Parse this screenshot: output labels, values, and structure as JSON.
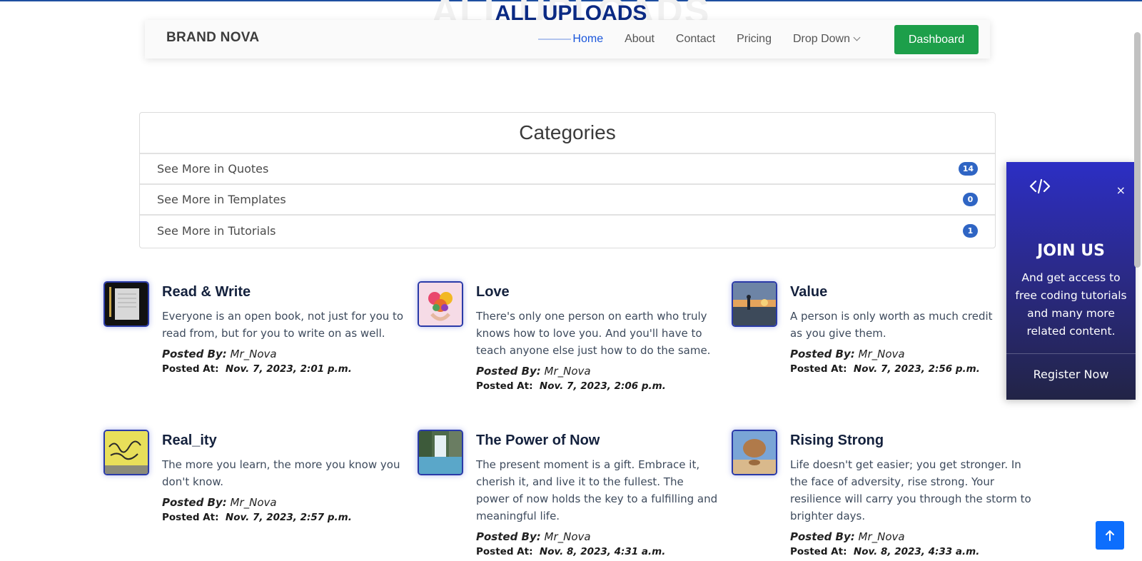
{
  "page": {
    "title_bg": "ALL UPLOADS",
    "title": "ALL UPLOADS"
  },
  "navbar": {
    "brand": "BRAND NOVA",
    "links": [
      {
        "label": "Home"
      },
      {
        "label": "About"
      },
      {
        "label": "Contact"
      },
      {
        "label": "Pricing"
      },
      {
        "label": "Drop Down"
      }
    ],
    "dashboard_label": "Dashboard"
  },
  "categories": {
    "title": "Categories",
    "items": [
      {
        "label": "See More in Quotes",
        "count": "14"
      },
      {
        "label": "See More in Templates",
        "count": "0"
      },
      {
        "label": "See More in Tutorials",
        "count": "1"
      }
    ]
  },
  "posts": [
    {
      "title": "Read & Write",
      "text": "Everyone is an open book, not just for you to read from, but for you to write on as well.",
      "by_label": "Posted By:",
      "author": "Mr_Nova",
      "at_label": "Posted At:",
      "date": "Nov. 7, 2023, 2:01 p.m."
    },
    {
      "title": "Love",
      "text": "There's only one person on earth who truly knows how to love you. And you'll have to teach anyone else just how to do the same.",
      "by_label": "Posted By:",
      "author": "Mr_Nova",
      "at_label": "Posted At:",
      "date": "Nov. 7, 2023, 2:06 p.m."
    },
    {
      "title": "Value",
      "text": "A person is only worth as much credit as you give them.",
      "by_label": "Posted By:",
      "author": "Mr_Nova",
      "at_label": "Posted At:",
      "date": "Nov. 7, 2023, 2:56 p.m."
    },
    {
      "title": "Real_ity",
      "text": "The more you learn, the more you know you don't know.",
      "by_label": "Posted By:",
      "author": "Mr_Nova",
      "at_label": "Posted At:",
      "date": "Nov. 7, 2023, 2:57 p.m."
    },
    {
      "title": "The Power of Now",
      "text": "The present moment is a gift. Embrace it, cherish it, and live it to the fullest. The power of now holds the key to a fulfilling and meaningful life.",
      "by_label": "Posted By:",
      "author": "Mr_Nova",
      "at_label": "Posted At:",
      "date": "Nov. 8, 2023, 4:31 a.m."
    },
    {
      "title": "Rising Strong",
      "text": "Life doesn't get easier; you get stronger. In the face of adversity, rise strong. Your resilience will carry you through the storm to brighter days.",
      "by_label": "Posted By:",
      "author": "Mr_Nova",
      "at_label": "Posted At:",
      "date": "Nov. 8, 2023, 4:33 a.m."
    }
  ],
  "join": {
    "icon": "code-icon",
    "close": "×",
    "title": "JOIN US",
    "text": "And get access to free coding tutorials and many more related content.",
    "register_label": "Register Now"
  },
  "colors": {
    "accent": "#1a56db",
    "dashboard": "#1d9f4a",
    "badge": "#2f65c4",
    "join_top": "#2c2ec4",
    "join_bottom": "#222446"
  }
}
